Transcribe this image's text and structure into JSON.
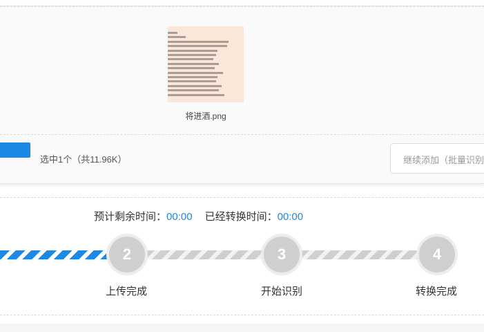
{
  "file": {
    "name": "将进酒.png"
  },
  "upload": {
    "selected_info": "选中1个（共11.96K）",
    "continue_add_label": "继续添加（批量识别"
  },
  "timer": {
    "remaining_label": "预计剩余时间：",
    "remaining_value": "00:00",
    "elapsed_label": "已经转换时间：",
    "elapsed_value": "00:00"
  },
  "steps": [
    {
      "number": "2",
      "label": "上传完成"
    },
    {
      "number": "3",
      "label": "开始识别"
    },
    {
      "number": "4",
      "label": "转换完成"
    }
  ],
  "colors": {
    "accent": "#1e88e5",
    "step_inactive": "#cfcfcf",
    "thumb_bg": "#fbe7d9"
  }
}
